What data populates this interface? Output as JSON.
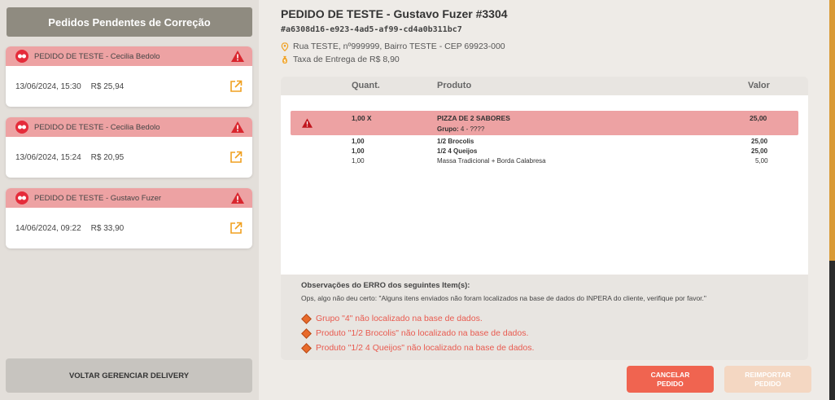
{
  "sidebar": {
    "title": "Pedidos Pendentes de Correção",
    "cards": [
      {
        "title": "PEDIDO DE TESTE - Cecilia Bedolo",
        "date": "13/06/2024, 15:30",
        "price": "R$ 25,94"
      },
      {
        "title": "PEDIDO DE TESTE - Cecilia Bedolo",
        "date": "13/06/2024, 15:24",
        "price": "R$ 20,95"
      },
      {
        "title": "PEDIDO DE TESTE - Gustavo Fuzer",
        "date": "14/06/2024, 09:22",
        "price": "R$ 33,90"
      }
    ],
    "back_label": "VOLTAR GERENCIAR DELIVERY"
  },
  "order": {
    "title": "PEDIDO DE TESTE - Gustavo Fuzer #3304",
    "id": "#a6308d16-e923-4ad5-af99-cd4a0b311bc7",
    "address": "Rua TESTE, nº999999, Bairro TESTE - CEP 69923-000",
    "fee": "Taxa de Entrega de R$ 8,90"
  },
  "table": {
    "headers": {
      "qty": "Quant.",
      "product": "Produto",
      "value": "Valor"
    },
    "main_item": {
      "qty": "1,00 X",
      "name": "PIZZA DE 2 SABORES",
      "group_label": "Grupo:",
      "group_value": "4 - ????",
      "value": "25,00"
    },
    "sub_items": [
      {
        "qty": "1,00",
        "name": "1/2 Brocolis",
        "value": "25,00",
        "bold": true
      },
      {
        "qty": "1,00",
        "name": "1/2 4 Queijos",
        "value": "25,00",
        "bold": true
      },
      {
        "qty": "1,00",
        "name": "Massa Tradicional + Borda Calabresa",
        "value": "5,00",
        "bold": false
      }
    ]
  },
  "observations": {
    "title": "Observações do ERRO dos seguintes Item(s):",
    "text": "Ops, algo não deu certo: \"Alguns itens enviados não foram localizados na base de dados do INPERA do cliente, verifique por favor.\"",
    "errors": [
      "Grupo \"4\" não localizado na base de dados.",
      "Produto \"1/2 Brocolis\" não localizado na base de dados.",
      "Produto \"1/2 4 Queijos\" não localizado na base de dados."
    ]
  },
  "actions": {
    "cancel_line1": "CANCELAR",
    "cancel_line2": "PEDIDO",
    "reimport_line1": "REIMPORTAR",
    "reimport_line2": "PEDIDO"
  },
  "colors": {
    "alert_row": "#eda2a3",
    "cancel": "#f06450",
    "error_text": "#e85a4f",
    "header_bar": "#8f8b80"
  },
  "icons": [
    "ifood-logo-icon",
    "warning-icon",
    "external-link-icon",
    "location-pin-icon",
    "money-bag-icon",
    "diamond-bullet-icon"
  ]
}
